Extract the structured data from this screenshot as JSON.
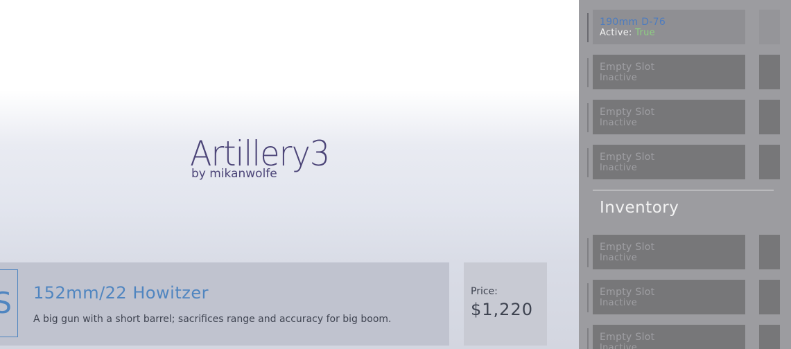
{
  "logo": {
    "title": "Artillery3",
    "subtitle": "by mikanwolfe"
  },
  "item": {
    "icon_letter": "S",
    "name": "152mm/22 Howitzer",
    "description": "A big gun with a short barrel; sacrifices range and accuracy for big boom."
  },
  "price": {
    "label": "Price:",
    "value": "$1,220"
  },
  "equipped_slots": [
    {
      "name": "190mm D-76",
      "status_label": "Active:",
      "status_value": "True"
    },
    {
      "name": "Empty Slot",
      "status_label": "Inactive"
    },
    {
      "name": "Empty Slot",
      "status_label": "Inactive"
    },
    {
      "name": "Empty Slot",
      "status_label": "Inactive"
    }
  ],
  "inventory": {
    "title": "Inventory",
    "slots": [
      {
        "name": "Empty Slot",
        "status_label": "Inactive"
      },
      {
        "name": "Empty Slot",
        "status_label": "Inactive"
      },
      {
        "name": "Empty Slot",
        "status_label": "Inactive"
      }
    ]
  }
}
